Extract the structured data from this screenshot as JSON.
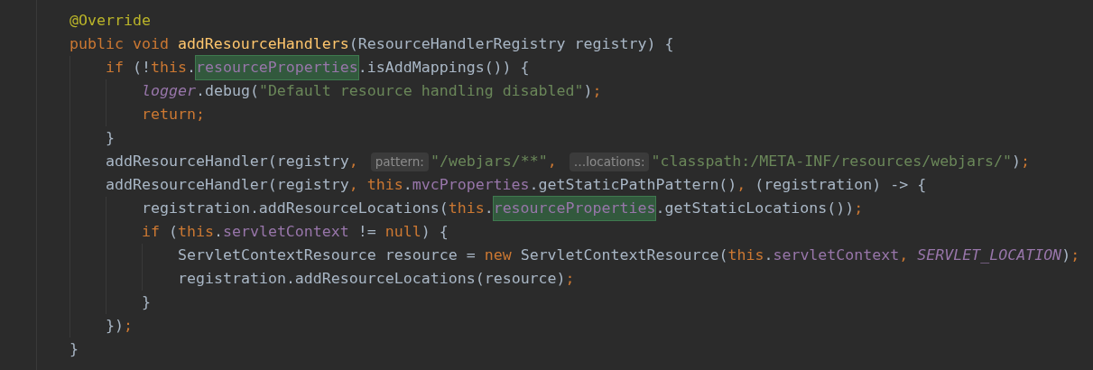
{
  "editor": {
    "lines": [
      {
        "tokens": [
          {
            "kind": "annotation",
            "text": "@Override"
          }
        ]
      },
      {
        "tokens": [
          {
            "kind": "keyword",
            "text": "public void "
          },
          {
            "kind": "declaration",
            "text": "addResourceHandlers"
          },
          {
            "kind": "plain",
            "text": "(ResourceHandlerRegistry registry) {"
          }
        ],
        "children": [
          {
            "tokens": [
              {
                "kind": "keyword",
                "text": "if"
              },
              {
                "kind": "plain",
                "text": " (!"
              },
              {
                "kind": "keyword",
                "text": "this"
              },
              {
                "kind": "plain",
                "text": "."
              },
              {
                "kind": "match",
                "text": "resourceProperties"
              },
              {
                "kind": "plain",
                "text": ".isAddMappings()) {"
              }
            ],
            "children": [
              {
                "tokens": [
                  {
                    "kind": "static",
                    "text": "logger"
                  },
                  {
                    "kind": "plain",
                    "text": ".debug("
                  },
                  {
                    "kind": "string",
                    "text": "\"Default resource handling disabled\""
                  },
                  {
                    "kind": "plain",
                    "text": ")"
                  },
                  {
                    "kind": "punct",
                    "text": ";"
                  }
                ]
              },
              {
                "tokens": [
                  {
                    "kind": "keyword",
                    "text": "return"
                  },
                  {
                    "kind": "punct",
                    "text": ";"
                  }
                ]
              }
            ]
          },
          {
            "tokens": [
              {
                "kind": "plain",
                "text": "}"
              }
            ]
          },
          {
            "tokens": [
              {
                "kind": "plain",
                "text": "addResourceHandler(registry"
              },
              {
                "kind": "punct",
                "text": ","
              },
              {
                "kind": "hint",
                "text": "pattern:"
              },
              {
                "kind": "string",
                "text": "\"/webjars/**\""
              },
              {
                "kind": "punct",
                "text": ","
              },
              {
                "kind": "hint",
                "text": "…locations:"
              },
              {
                "kind": "string",
                "text": "\"classpath:/META-INF/resources/webjars/\""
              },
              {
                "kind": "plain",
                "text": ")"
              },
              {
                "kind": "punct",
                "text": ";"
              }
            ]
          },
          {
            "tokens": [
              {
                "kind": "plain",
                "text": "addResourceHandler(registry"
              },
              {
                "kind": "punct",
                "text": ", "
              },
              {
                "kind": "keyword",
                "text": "this"
              },
              {
                "kind": "plain",
                "text": "."
              },
              {
                "kind": "field",
                "text": "mvcProperties"
              },
              {
                "kind": "plain",
                "text": ".getStaticPathPattern()"
              },
              {
                "kind": "punct",
                "text": ", "
              },
              {
                "kind": "plain",
                "text": "(registration) -> {"
              }
            ],
            "children": [
              {
                "tokens": [
                  {
                    "kind": "plain",
                    "text": "registration.addResourceLocations("
                  },
                  {
                    "kind": "keyword",
                    "text": "this"
                  },
                  {
                    "kind": "plain",
                    "text": "."
                  },
                  {
                    "kind": "match",
                    "text": "resourceProperties"
                  },
                  {
                    "kind": "plain",
                    "text": ".getStaticLocations())"
                  },
                  {
                    "kind": "punct",
                    "text": ";"
                  }
                ]
              },
              {
                "tokens": [
                  {
                    "kind": "keyword",
                    "text": "if"
                  },
                  {
                    "kind": "plain",
                    "text": " ("
                  },
                  {
                    "kind": "keyword",
                    "text": "this"
                  },
                  {
                    "kind": "plain",
                    "text": "."
                  },
                  {
                    "kind": "field",
                    "text": "servletContext"
                  },
                  {
                    "kind": "plain",
                    "text": " != "
                  },
                  {
                    "kind": "keyword",
                    "text": "null"
                  },
                  {
                    "kind": "plain",
                    "text": ") {"
                  }
                ],
                "children": [
                  {
                    "tokens": [
                      {
                        "kind": "plain",
                        "text": "ServletContextResource resource = "
                      },
                      {
                        "kind": "keyword",
                        "text": "new"
                      },
                      {
                        "kind": "plain",
                        "text": " ServletContextResource("
                      },
                      {
                        "kind": "keyword",
                        "text": "this"
                      },
                      {
                        "kind": "plain",
                        "text": "."
                      },
                      {
                        "kind": "field",
                        "text": "servletContext"
                      },
                      {
                        "kind": "punct",
                        "text": ", "
                      },
                      {
                        "kind": "static",
                        "text": "SERVLET_LOCATION"
                      },
                      {
                        "kind": "plain",
                        "text": ")"
                      },
                      {
                        "kind": "punct",
                        "text": ";"
                      }
                    ]
                  },
                  {
                    "tokens": [
                      {
                        "kind": "plain",
                        "text": "registration.addResourceLocations(resource)"
                      },
                      {
                        "kind": "punct",
                        "text": ";"
                      }
                    ]
                  }
                ]
              },
              {
                "tokens": [
                  {
                    "kind": "plain",
                    "text": "}"
                  }
                ]
              }
            ]
          },
          {
            "tokens": [
              {
                "kind": "plain",
                "text": "})"
              },
              {
                "kind": "punct",
                "text": ";"
              }
            ]
          }
        ]
      },
      {
        "tokens": [
          {
            "kind": "plain",
            "text": "}"
          }
        ]
      }
    ]
  }
}
